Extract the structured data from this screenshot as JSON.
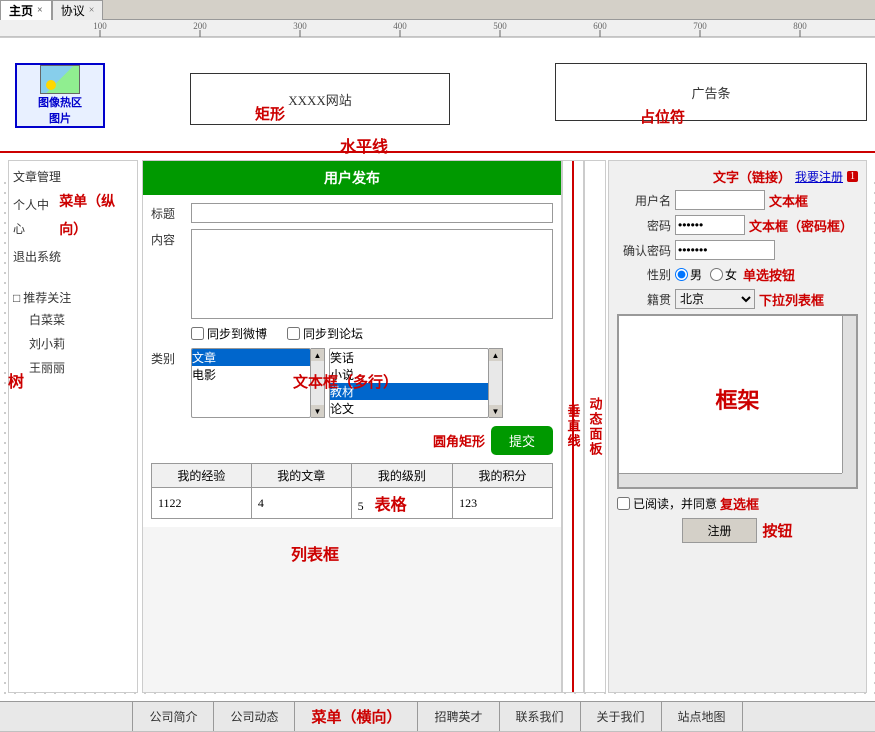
{
  "tabs": [
    {
      "label": "主页",
      "active": true
    },
    {
      "label": "协议",
      "active": false
    }
  ],
  "ruler": {
    "marks": [
      100,
      200,
      300,
      400,
      500,
      600,
      700,
      800
    ]
  },
  "header": {
    "image_label1": "图像热区",
    "image_label2": "图片",
    "xxxx_site": "XXXX网站",
    "rect_label": "矩形",
    "ad_label": "广告条",
    "placeholder_label": "占位符",
    "hline_label": "水平线"
  },
  "left_menu": {
    "items": [
      "文章管理",
      "个人中心",
      "退出系统"
    ],
    "label": "菜单（纵向）",
    "tree_header": "推荐关注",
    "tree_items": [
      "白菜菜",
      "刘小莉",
      "王丽丽"
    ],
    "tree_label": "树"
  },
  "form": {
    "header": "用户发布",
    "title_label": "标题",
    "content_label": "内容",
    "textarea_label": "文本框（多行）",
    "sync_weibo": "同步到微博",
    "sync_forum": "同步到论坛",
    "category_label": "类别",
    "categories_left": [
      "文章",
      "电影"
    ],
    "categories_right": [
      "笑话",
      "小说",
      "教材",
      "论文"
    ],
    "selected_left": "文章",
    "selected_right": "教材",
    "listbox_label": "列表框",
    "roundrect_label": "圆角矩形",
    "submit_btn": "提交"
  },
  "table": {
    "label": "表格",
    "headers": [
      "我的经验",
      "我的文章",
      "我的级别",
      "我的积分"
    ],
    "row": [
      "1122",
      "4",
      "5",
      "123"
    ]
  },
  "vertical": {
    "line_label": "垂",
    "line_label2": "直",
    "line_label3": "线",
    "dynamic_label": "动",
    "dynamic_label2": "态",
    "dynamic_label3": "面",
    "dynamic_label4": "板"
  },
  "right_panel": {
    "link_text": "我要注册",
    "badge": "1",
    "link_label": "文字（链接）",
    "username_label": "用户名",
    "username_placeholder": "文本框",
    "textbox_label": "文本框",
    "password_label": "密码",
    "password_value": "••••••",
    "password_label2": "文本框（密码框）",
    "confirm_label": "确认密码",
    "confirm_value": "•••••••",
    "gender_label": "性别",
    "gender_male": "男",
    "gender_female": "女",
    "radio_label": "单选按钮",
    "籍贯_label": "籍贯",
    "籍贯_value": "北京",
    "dropdown_label": "下拉列表框",
    "frame_label": "框架",
    "agree_text": "已阅读，并同意",
    "checkbox_label": "复选框",
    "register_btn": "注册",
    "btn_label": "按钮"
  },
  "bottom_nav": {
    "items": [
      "公司简介",
      "公司动态",
      "菜单（横向）",
      "招聘英才",
      "联系我们",
      "关于我们",
      "站点地图"
    ],
    "label": "菜单（横向）"
  }
}
